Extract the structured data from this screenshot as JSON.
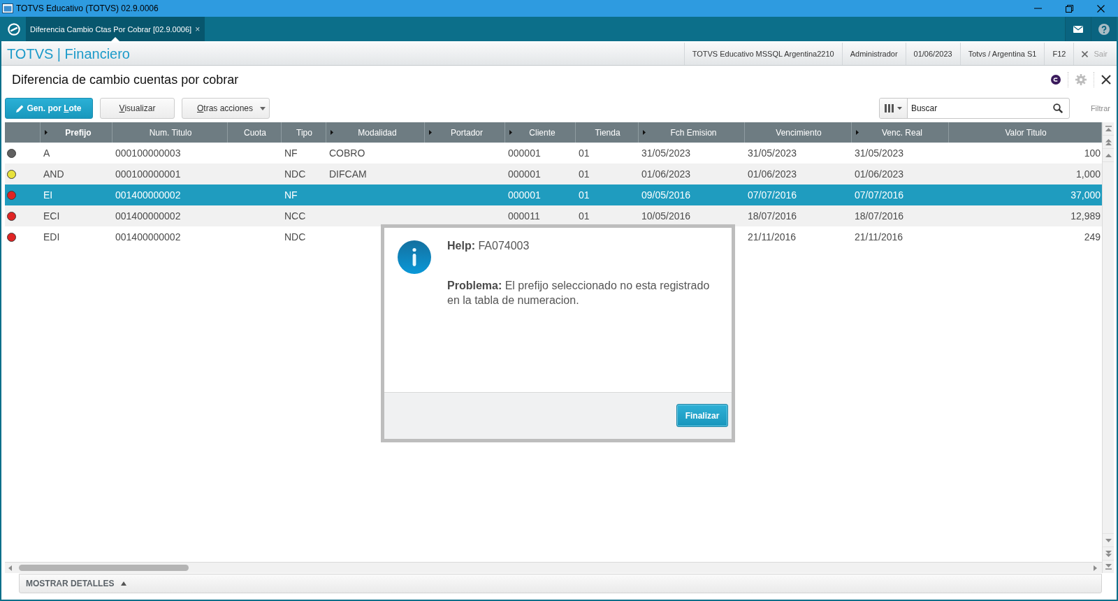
{
  "window": {
    "title": "TOTVS Educativo (TOTVS) 02.9.0006"
  },
  "tabs": [
    {
      "label": "Diferencia Cambio Ctas Por Cobrar [02.9.0006]",
      "close": "×",
      "selected": true
    }
  ],
  "header": {
    "module": "TOTVS | Financiero",
    "items": [
      "TOTVS Educativo MSSQL Argentina2210",
      "Administrador",
      "01/06/2023",
      "Totvs / Argentina S1",
      "F12"
    ],
    "exit": "Sair"
  },
  "page": {
    "title": "Diferencia de cambio cuentas por cobrar"
  },
  "toolbar": {
    "buttons": [
      {
        "kind": "primary",
        "label": [
          {
            "text": "Gen. por ",
            "underlined": false
          },
          {
            "text": "L",
            "underlined": true
          },
          {
            "text": "ote",
            "underlined": false
          }
        ]
      },
      {
        "kind": "default",
        "label": [
          {
            "text": "V",
            "underlined": true
          },
          {
            "text": "isualizar",
            "underlined": false
          }
        ]
      },
      {
        "kind": "menu",
        "label": [
          {
            "text": "O",
            "underlined": true
          },
          {
            "text": "tras acciones",
            "underlined": false
          }
        ]
      }
    ],
    "search": {
      "placeholder": "Buscar"
    },
    "filter": "Filtrar"
  },
  "table": {
    "columns": [
      {
        "label": "Prefijo",
        "arrow": true,
        "sorted": true
      },
      {
        "label": "Num. Titulo",
        "arrow": false,
        "sorted": false
      },
      {
        "label": "Cuota",
        "arrow": false,
        "sorted": false
      },
      {
        "label": "Tipo",
        "arrow": false,
        "sorted": false
      },
      {
        "label": "Modalidad",
        "arrow": true,
        "sorted": false
      },
      {
        "label": "Portador",
        "arrow": true,
        "sorted": false
      },
      {
        "label": "Cliente",
        "arrow": true,
        "sorted": false
      },
      {
        "label": "Tienda",
        "arrow": false,
        "sorted": false
      },
      {
        "label": "Fch Emision",
        "arrow": true,
        "sorted": false
      },
      {
        "label": "Vencimiento",
        "arrow": false,
        "sorted": false
      },
      {
        "label": "Venc. Real",
        "arrow": true,
        "sorted": false
      },
      {
        "label": "Valor Titulo",
        "arrow": false,
        "sorted": false
      }
    ],
    "rows": [
      {
        "color": "#606060",
        "selected": false,
        "cells": [
          "A",
          "000100000003",
          null,
          "NF",
          "COBRO",
          null,
          "000001",
          "01",
          "31/05/2023",
          "31/05/2023",
          "31/05/2023",
          "100"
        ]
      },
      {
        "color": "#e8e23c",
        "selected": false,
        "cells": [
          "AND",
          "000100000001",
          null,
          "NDC",
          "DIFCAM",
          null,
          "000001",
          "01",
          "01/06/2023",
          "01/06/2023",
          "01/06/2023",
          "1,000"
        ]
      },
      {
        "color": "#e02424",
        "selected": true,
        "cells": [
          "EI",
          "001400000002",
          null,
          "NF",
          null,
          null,
          "000001",
          "01",
          "09/05/2016",
          "07/07/2016",
          "07/07/2016",
          "37,000"
        ]
      },
      {
        "color": "#e02424",
        "selected": false,
        "cells": [
          "ECI",
          "001400000002",
          null,
          "NCC",
          null,
          null,
          "000011",
          "01",
          "10/05/2016",
          "18/07/2016",
          "18/07/2016",
          "12,989"
        ]
      },
      {
        "color": "#e02424",
        "selected": false,
        "cells": [
          "EDI",
          "001400000002",
          null,
          "NDC",
          null,
          null,
          null,
          null,
          null,
          "21/11/2016",
          "21/11/2016",
          "249"
        ]
      }
    ]
  },
  "details_bar": {
    "label": "MOSTRAR DETALLES",
    "expanded": false
  },
  "dialog": {
    "title": "**Help:** FA074003",
    "message": "**Problema:** El prefijo seleccionado no esta registrado en la tabla de numeracion.",
    "button": "Finalizar"
  }
}
